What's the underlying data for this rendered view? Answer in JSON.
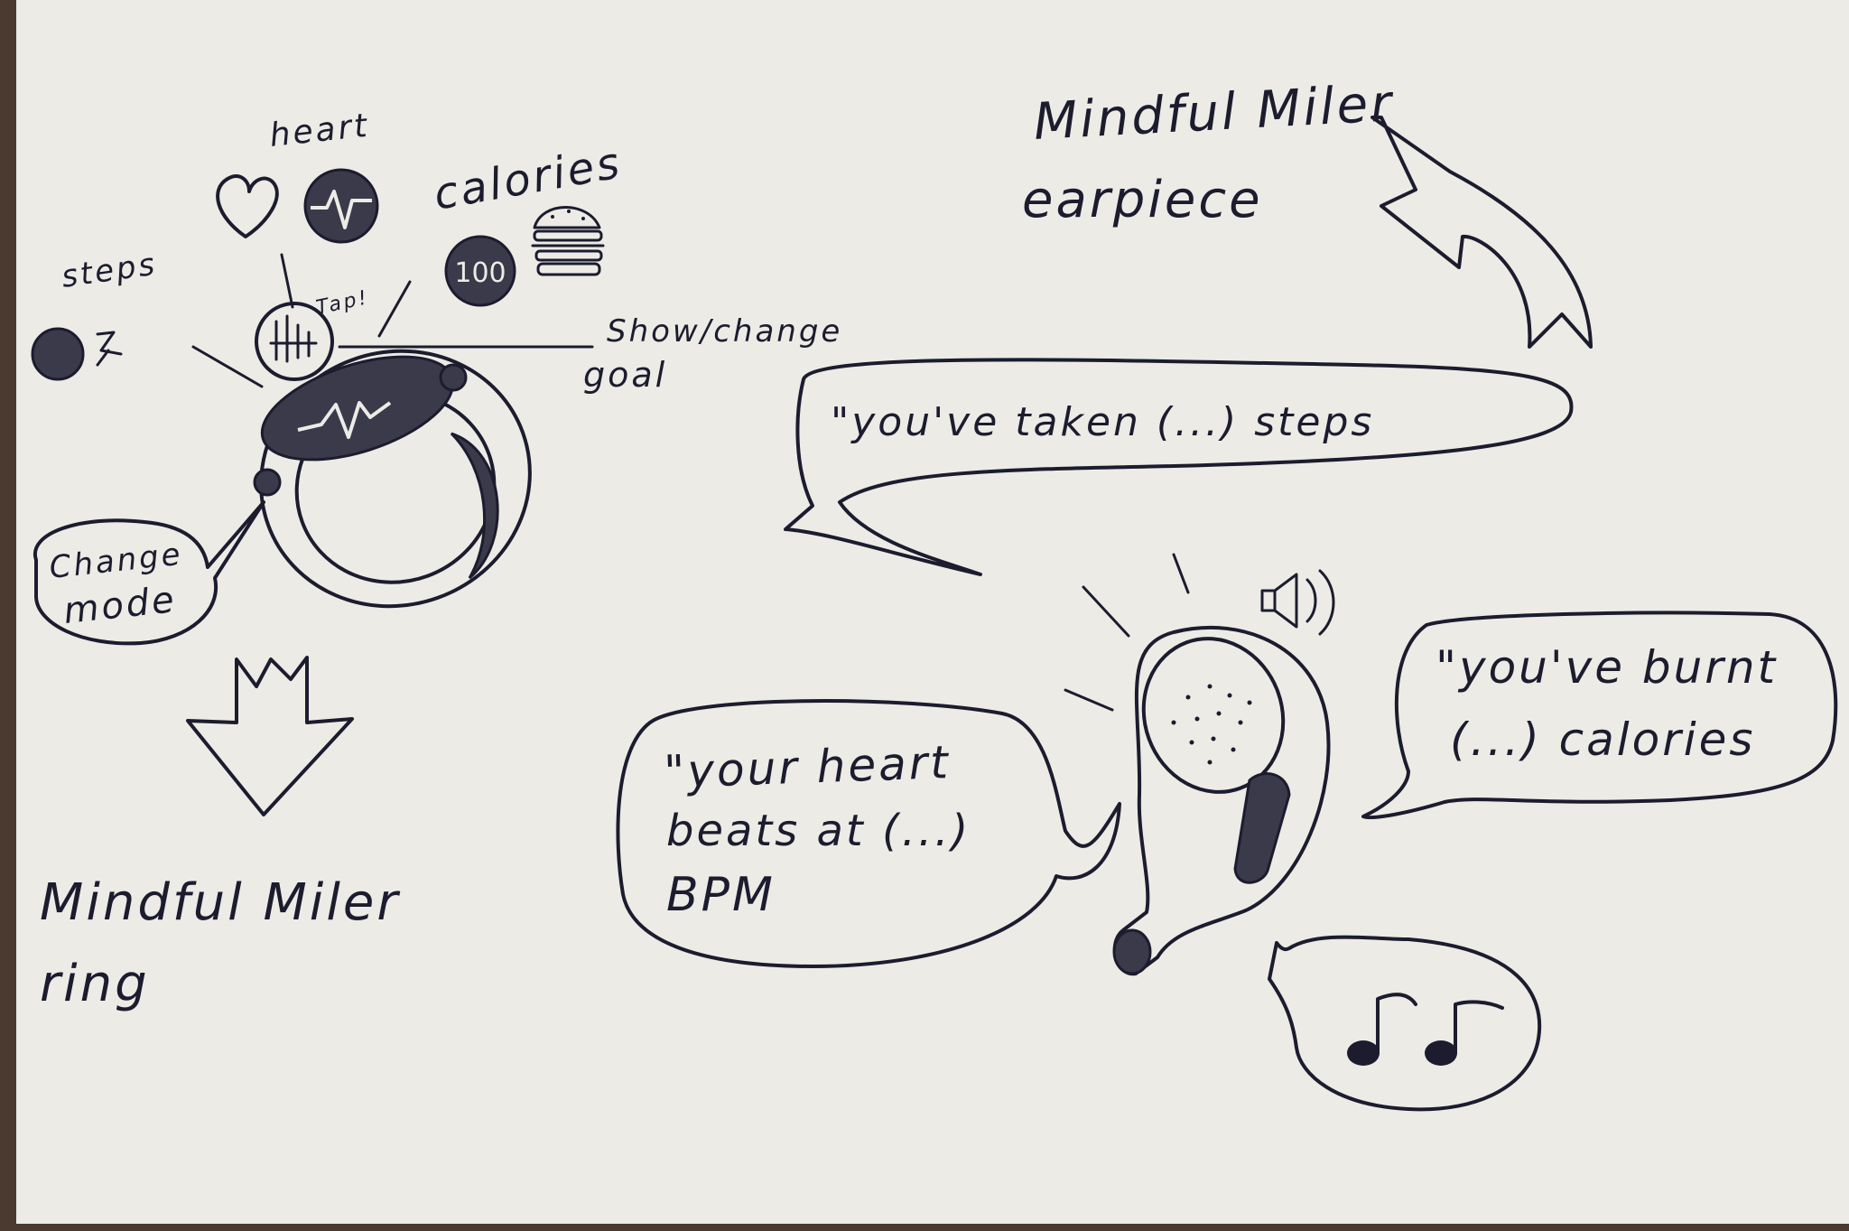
{
  "ring": {
    "title_line1": "Mindful Miler",
    "title_line2": "ring",
    "icons": {
      "steps": "steps",
      "heart": "heart",
      "calories": "calories",
      "calorie_counter": "100"
    },
    "callouts": {
      "tap": "Tap!",
      "show_change_goal_line1": "Show/change",
      "show_change_goal_line2": "goal",
      "change_mode_line1": "Change",
      "change_mode_line2": "mode"
    }
  },
  "earpiece": {
    "title_line1": "Mindful Miler",
    "title_line2": "earpiece",
    "bubbles": {
      "steps": "\"you've taken (...) steps",
      "heart_line1": "\"your heart",
      "heart_line2": "beats at (...)",
      "heart_line3": "BPM",
      "calories_line1": "\"you've burnt",
      "calories_line2": "(...) calories"
    },
    "music_icon": "music-notes-icon",
    "speaker_icon": "speaker-icon"
  },
  "colors": {
    "paper": "#ecebe6",
    "ink": "#1c1c2e",
    "fill": "#3a3a4a",
    "background": "#4a3a30"
  }
}
